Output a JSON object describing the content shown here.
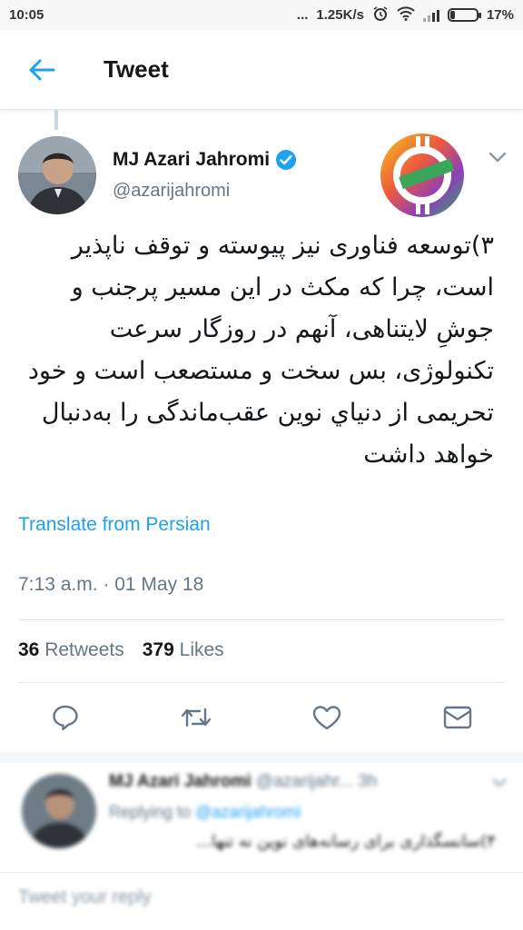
{
  "status_bar": {
    "time": "10:05",
    "dots": "...",
    "network_speed": "1.25K/s",
    "battery_percent": "17%",
    "battery_level": 0.17
  },
  "header": {
    "title": "Tweet",
    "back_icon": "arrow-left-icon"
  },
  "tweet": {
    "author_name": "MJ Azari Jahromi",
    "handle": "@azarijahromi",
    "verified": true,
    "text": "۳)توسعه فناوری نیز پیوسته و توقف ناپذیر است، چرا که مکث در این مسیر پرجنب و جوشِ لایتناهی، آنهم در روزگار سرعت تکنولوژی، بس سخت و مستصعب است و خود تحریمی از دنیاي نوین عقب‌ماندگی را به‌دنبال خواهد داشت",
    "translate_label": "Translate from Persian",
    "timestamp": "7:13 a.m. · 01 May 18",
    "retweets_count": "36",
    "retweets_label": "Retweets",
    "likes_count": "379",
    "likes_label": "Likes"
  },
  "actions": {
    "reply_icon": "reply-icon",
    "retweet_icon": "retweet-icon",
    "like_icon": "heart-icon",
    "message_icon": "mail-icon"
  },
  "reply_preview": {
    "author_name": "MJ Azari Jahromi",
    "handle": "@azarijahr...",
    "time": "3h",
    "replying_prefix": "Replying to",
    "replying_handle": "@azarijahromi",
    "text": "۴)سانسگذاری برای رسانه‌های نوین نه تنها..."
  },
  "compose": {
    "placeholder": "Tweet your reply"
  },
  "colors": {
    "accent": "#1da1f2",
    "text_primary": "#14171a",
    "text_secondary": "#657786",
    "border": "#e1e8ed"
  }
}
